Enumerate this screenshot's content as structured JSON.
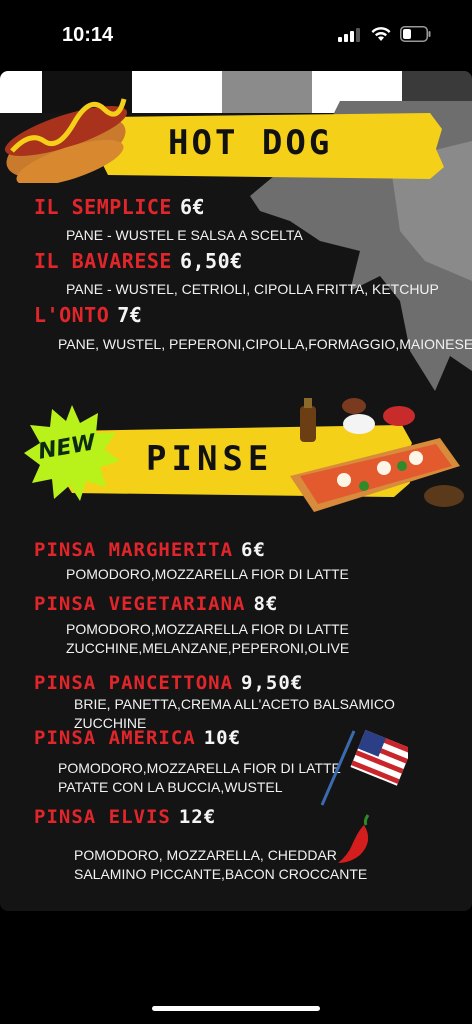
{
  "status": {
    "time": "10:14"
  },
  "hotdog": {
    "title": "HOT DOG",
    "items": [
      {
        "name": "IL SEMPLICE",
        "price": "6€",
        "desc": [
          "PANE - WUSTEL E SALSA A SCELTA"
        ]
      },
      {
        "name": "IL BAVARESE",
        "price": "6,50€",
        "desc": [
          "PANE - WUSTEL, CETRIOLI, CIPOLLA FRITTA, KETCHUP"
        ]
      },
      {
        "name": "L'ONTO",
        "price": "7€",
        "desc": [
          "PANE, WUSTEL, PEPERONI,CIPOLLA,FORMAGGIO,MAIONESE"
        ]
      }
    ]
  },
  "pinse": {
    "badge": "NEW",
    "title": "PINSE",
    "items": [
      {
        "name": "PINSA MARGHERITA",
        "price": "6€",
        "desc": [
          "POMODORO,MOZZARELLA FIOR DI LATTE"
        ]
      },
      {
        "name": "PINSA VEGETARIANA",
        "price": "8€",
        "desc": [
          "POMODORO,MOZZARELLA FIOR DI LATTE",
          "ZUCCHINE,MELANZANE,PEPERONI,OLIVE"
        ]
      },
      {
        "name": "PINSA PANCETTONA",
        "price": "9,50€",
        "desc": [
          "BRIE, PANETTA,CREMA ALL'ACETO BALSAMICO",
          "ZUCCHINE"
        ]
      },
      {
        "name": "PINSA AMERICA",
        "price": "10€",
        "desc": [
          "POMODORO,MOZZARELLA FIOR DI LATTE",
          "PATATE CON LA BUCCIA,WUSTEL"
        ]
      },
      {
        "name": "PINSA ELVIS",
        "price": "12€",
        "desc": [
          "POMODORO, MOZZARELLA, CHEDDAR",
          "SALAMINO PICCANTE,BACON CROCCANTE"
        ]
      }
    ]
  },
  "colors": {
    "accent_red": "#e0262b",
    "banner_yellow": "#f5d019",
    "badge_green": "#b8f21a",
    "card_bg": "#141414"
  },
  "icons": [
    "cellular-signal-icon",
    "wifi-icon",
    "battery-icon",
    "hotdog-illustration",
    "pizza-illustration",
    "usa-flag-icon",
    "chili-pepper-icon"
  ]
}
